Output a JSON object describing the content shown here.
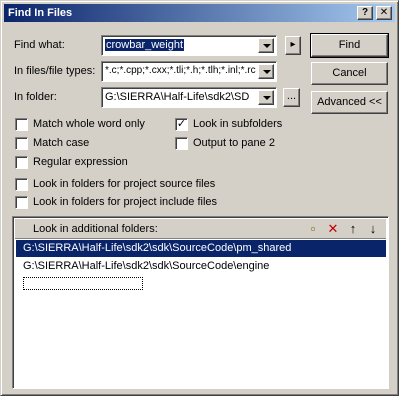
{
  "window": {
    "title": "Find In Files",
    "help_glyph": "?",
    "close_glyph": "✕"
  },
  "find_what": {
    "label": "Find what:",
    "value": "crowbar_weight"
  },
  "file_types": {
    "label": "In files/file types:",
    "value": "*.c;*.cpp;*.cxx;*.tli;*.h;*.tlh;*.inl;*.rc"
  },
  "in_folder": {
    "label": "In folder:",
    "value": "G:\\SIERRA\\Half-Life\\sdk2\\SD",
    "browse_label": "..."
  },
  "arrow_button": "▸",
  "buttons": {
    "find": "Find",
    "cancel": "Cancel",
    "advanced": "Advanced <<"
  },
  "options": {
    "whole_word": {
      "label": "Match whole word only",
      "checked": false
    },
    "match_case": {
      "label": "Match case",
      "checked": false
    },
    "regex": {
      "label": "Regular expression",
      "checked": false
    },
    "project_source": {
      "label": "Look in folders for project source files",
      "checked": false
    },
    "project_include": {
      "label": "Look in folders for project include files",
      "checked": false
    },
    "subfolders": {
      "label": "Look in subfolders",
      "checked": true
    },
    "pane2": {
      "label": "Output to pane 2",
      "checked": false
    }
  },
  "check_glyph": "✓",
  "additional": {
    "header": "Look in additional folders:",
    "icons": {
      "new": "new-folder-icon",
      "delete": "delete-icon",
      "up": "arrow-up-icon",
      "down": "arrow-down-icon"
    },
    "glyphs": {
      "new": "▫",
      "delete": "✕",
      "up": "↑",
      "down": "↓"
    },
    "folders": [
      "G:\\SIERRA\\Half-Life\\sdk2\\sdk\\SourceCode\\pm_shared",
      "G:\\SIERRA\\Half-Life\\sdk2\\sdk\\SourceCode\\engine"
    ]
  },
  "colors": {
    "title_start": "#0a246a",
    "title_end": "#a6caf0",
    "selection": "#0a246a",
    "face": "#d4d0c8"
  }
}
